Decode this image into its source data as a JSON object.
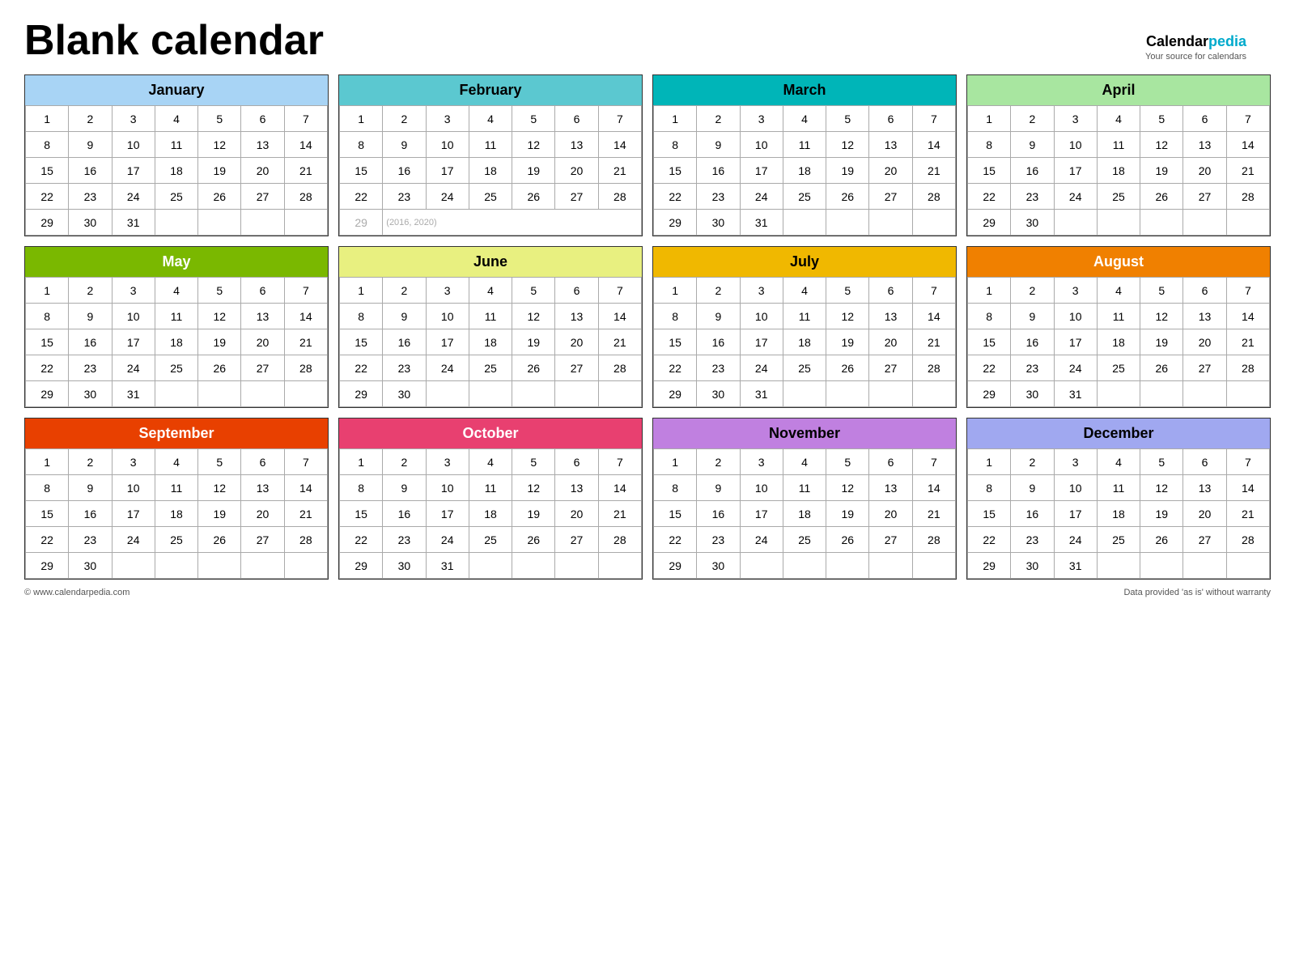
{
  "title": "Blank calendar",
  "logo": {
    "name1": "Calendar",
    "name2": "pedia",
    "tagline": "Your source for calendars"
  },
  "footer": {
    "left": "© www.calendarpedia.com",
    "right": "Data provided 'as is' without warranty"
  },
  "months": [
    {
      "name": "January",
      "class": "jan",
      "rows": [
        [
          1,
          2,
          3,
          4,
          5,
          6,
          7
        ],
        [
          8,
          9,
          10,
          11,
          12,
          13,
          14
        ],
        [
          15,
          16,
          17,
          18,
          19,
          20,
          21
        ],
        [
          22,
          23,
          24,
          25,
          26,
          27,
          28
        ],
        [
          29,
          30,
          31,
          "",
          "",
          "",
          ""
        ]
      ]
    },
    {
      "name": "February",
      "class": "feb",
      "rows": [
        [
          1,
          2,
          3,
          4,
          5,
          6,
          7
        ],
        [
          8,
          9,
          10,
          11,
          12,
          13,
          14
        ],
        [
          15,
          16,
          17,
          18,
          19,
          20,
          21
        ],
        [
          22,
          23,
          24,
          25,
          26,
          27,
          28
        ],
        [
          "29leap",
          "(2016, 2020)",
          "",
          "",
          "",
          "",
          ""
        ]
      ]
    },
    {
      "name": "March",
      "class": "mar",
      "rows": [
        [
          1,
          2,
          3,
          4,
          5,
          6,
          7
        ],
        [
          8,
          9,
          10,
          11,
          12,
          13,
          14
        ],
        [
          15,
          16,
          17,
          18,
          19,
          20,
          21
        ],
        [
          22,
          23,
          24,
          25,
          26,
          27,
          28
        ],
        [
          29,
          30,
          31,
          "",
          "",
          "",
          ""
        ]
      ]
    },
    {
      "name": "April",
      "class": "apr",
      "rows": [
        [
          1,
          2,
          3,
          4,
          5,
          6,
          7
        ],
        [
          8,
          9,
          10,
          11,
          12,
          13,
          14
        ],
        [
          15,
          16,
          17,
          18,
          19,
          20,
          21
        ],
        [
          22,
          23,
          24,
          25,
          26,
          27,
          28
        ],
        [
          29,
          30,
          "",
          "",
          "",
          "",
          ""
        ]
      ]
    },
    {
      "name": "May",
      "class": "may",
      "rows": [
        [
          1,
          2,
          3,
          4,
          5,
          6,
          7
        ],
        [
          8,
          9,
          10,
          11,
          12,
          13,
          14
        ],
        [
          15,
          16,
          17,
          18,
          19,
          20,
          21
        ],
        [
          22,
          23,
          24,
          25,
          26,
          27,
          28
        ],
        [
          29,
          30,
          31,
          "",
          "",
          "",
          ""
        ]
      ]
    },
    {
      "name": "June",
      "class": "jun",
      "rows": [
        [
          1,
          2,
          3,
          4,
          5,
          6,
          7
        ],
        [
          8,
          9,
          10,
          11,
          12,
          13,
          14
        ],
        [
          15,
          16,
          17,
          18,
          19,
          20,
          21
        ],
        [
          22,
          23,
          24,
          25,
          26,
          27,
          28
        ],
        [
          29,
          30,
          "",
          "",
          "",
          "",
          ""
        ]
      ]
    },
    {
      "name": "July",
      "class": "jul",
      "rows": [
        [
          1,
          2,
          3,
          4,
          5,
          6,
          7
        ],
        [
          8,
          9,
          10,
          11,
          12,
          13,
          14
        ],
        [
          15,
          16,
          17,
          18,
          19,
          20,
          21
        ],
        [
          22,
          23,
          24,
          25,
          26,
          27,
          28
        ],
        [
          29,
          30,
          31,
          "",
          "",
          "",
          ""
        ]
      ]
    },
    {
      "name": "August",
      "class": "aug",
      "rows": [
        [
          1,
          2,
          3,
          4,
          5,
          6,
          7
        ],
        [
          8,
          9,
          10,
          11,
          12,
          13,
          14
        ],
        [
          15,
          16,
          17,
          18,
          19,
          20,
          21
        ],
        [
          22,
          23,
          24,
          25,
          26,
          27,
          28
        ],
        [
          29,
          30,
          31,
          "",
          "",
          "",
          ""
        ]
      ]
    },
    {
      "name": "September",
      "class": "sep",
      "rows": [
        [
          1,
          2,
          3,
          4,
          5,
          6,
          7
        ],
        [
          8,
          9,
          10,
          11,
          12,
          13,
          14
        ],
        [
          15,
          16,
          17,
          18,
          19,
          20,
          21
        ],
        [
          22,
          23,
          24,
          25,
          26,
          27,
          28
        ],
        [
          29,
          30,
          "",
          "",
          "",
          "",
          ""
        ]
      ]
    },
    {
      "name": "October",
      "class": "oct",
      "rows": [
        [
          1,
          2,
          3,
          4,
          5,
          6,
          7
        ],
        [
          8,
          9,
          10,
          11,
          12,
          13,
          14
        ],
        [
          15,
          16,
          17,
          18,
          19,
          20,
          21
        ],
        [
          22,
          23,
          24,
          25,
          26,
          27,
          28
        ],
        [
          29,
          30,
          31,
          "",
          "",
          "",
          ""
        ]
      ]
    },
    {
      "name": "November",
      "class": "nov",
      "rows": [
        [
          1,
          2,
          3,
          4,
          5,
          6,
          7
        ],
        [
          8,
          9,
          10,
          11,
          12,
          13,
          14
        ],
        [
          15,
          16,
          17,
          18,
          19,
          20,
          21
        ],
        [
          22,
          23,
          24,
          25,
          26,
          27,
          28
        ],
        [
          29,
          30,
          "",
          "",
          "",
          "",
          ""
        ]
      ]
    },
    {
      "name": "December",
      "class": "dec",
      "rows": [
        [
          1,
          2,
          3,
          4,
          5,
          6,
          7
        ],
        [
          8,
          9,
          10,
          11,
          12,
          13,
          14
        ],
        [
          15,
          16,
          17,
          18,
          19,
          20,
          21
        ],
        [
          22,
          23,
          24,
          25,
          26,
          27,
          28
        ],
        [
          29,
          30,
          31,
          "",
          "",
          "",
          ""
        ]
      ]
    }
  ]
}
